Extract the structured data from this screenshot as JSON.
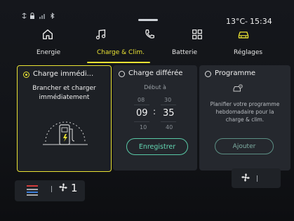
{
  "status_bar": {
    "temperature": "13°C",
    "separator": "-",
    "time": "15:34",
    "icons": [
      "sync-icon",
      "lock-icon",
      "signal-icon",
      "bluetooth-icon"
    ]
  },
  "app_shortcuts": [
    "home-icon",
    "music-icon",
    "phone-icon",
    "apps-grid-icon",
    "car-icon"
  ],
  "tabs": [
    {
      "label": "Energie",
      "active": false
    },
    {
      "label": "Charge & Clim.",
      "active": true
    },
    {
      "label": "Batterie",
      "active": false
    },
    {
      "label": "Réglages",
      "active": false
    }
  ],
  "accent_color": "#e9e233",
  "cards": {
    "immediate": {
      "title": "Charge immédi...",
      "selected": true,
      "description_line1": "Brancher et charger",
      "description_line2": "immédiatement"
    },
    "deferred": {
      "title": "Charge différée",
      "selected": false,
      "start_label": "Début à",
      "hour_prev": "08",
      "hour": "09",
      "hour_next": "10",
      "minute_prev": "30",
      "minute": "35",
      "minute_next": "40",
      "colon": ":",
      "save_label": "Enregistrer"
    },
    "program": {
      "title": "Programme",
      "selected": false,
      "description_line1": "Planifier votre programme",
      "description_line2": "hebdomadaire pour la",
      "description_line3": "charge & clim.",
      "add_label": "Ajouter"
    }
  },
  "bottom_bar": {
    "fan_level": "1"
  }
}
